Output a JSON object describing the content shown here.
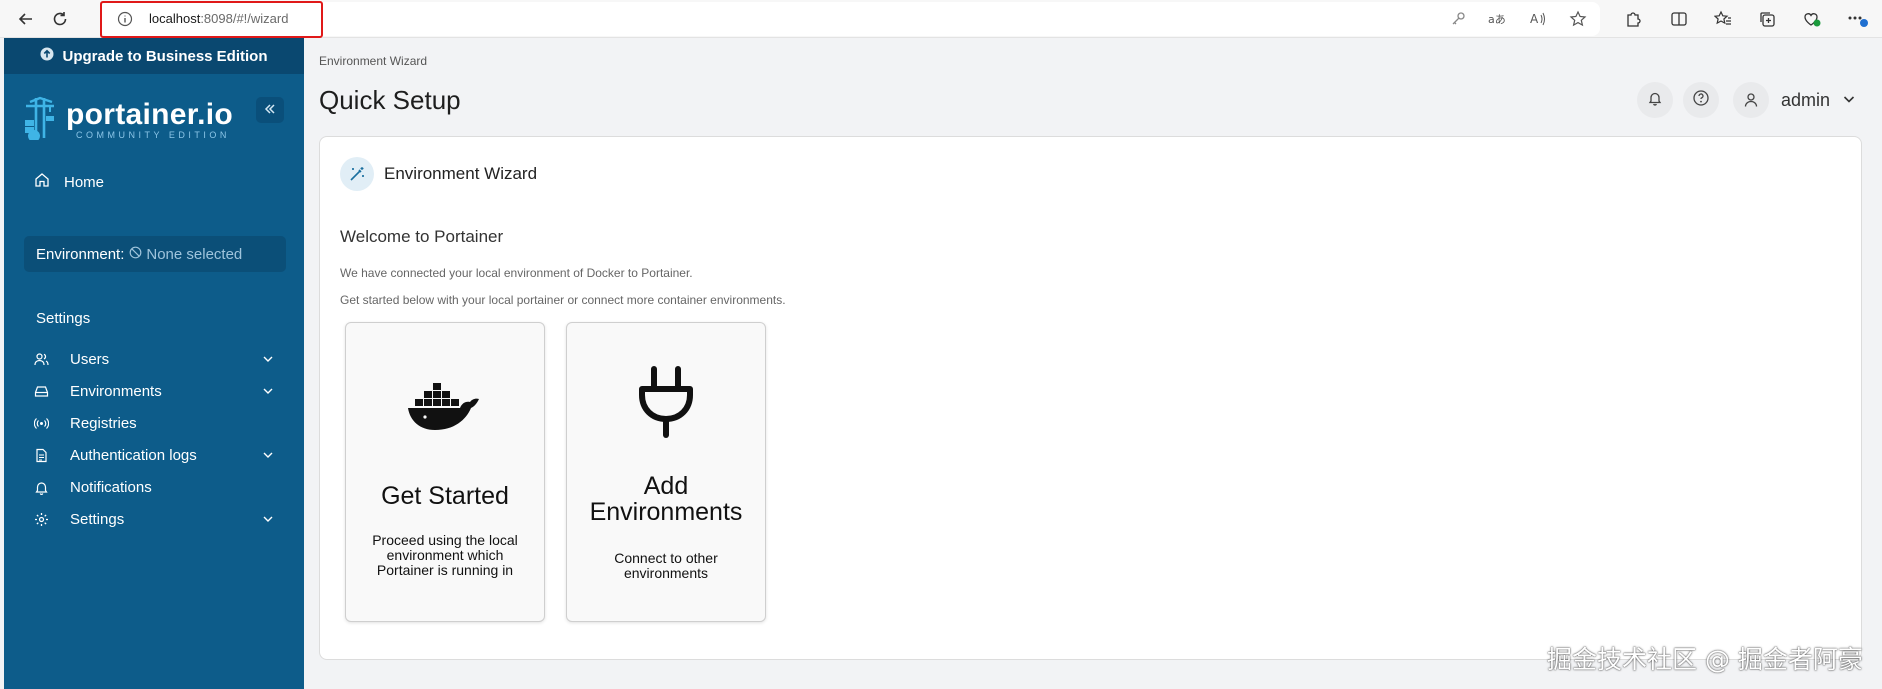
{
  "browser": {
    "url_host": "localhost",
    "url_rest": ":8098/#!/wizard"
  },
  "sidebar": {
    "upgrade_label": "Upgrade to Business Edition",
    "logo_name": "portainer.io",
    "logo_sub": "COMMUNITY EDITION",
    "home_label": "Home",
    "environment_label": "Environment:",
    "environment_value": "None selected",
    "settings_title": "Settings",
    "items": [
      {
        "label": "Users",
        "icon": "users-icon",
        "expandable": true
      },
      {
        "label": "Environments",
        "icon": "environments-icon",
        "expandable": true
      },
      {
        "label": "Registries",
        "icon": "radio-icon",
        "expandable": false
      },
      {
        "label": "Authentication logs",
        "icon": "file-text-icon",
        "expandable": true
      },
      {
        "label": "Notifications",
        "icon": "bell-icon",
        "expandable": false
      },
      {
        "label": "Settings",
        "icon": "gear-icon",
        "expandable": true
      }
    ]
  },
  "header": {
    "breadcrumb": "Environment Wizard",
    "title": "Quick Setup",
    "user": "admin"
  },
  "wizard": {
    "heading": "Environment Wizard",
    "welcome": "Welcome to Portainer",
    "description_1": "We have connected your local environment of Docker to Portainer.",
    "description_2": "Get started below with your local portainer or connect more container environments.",
    "options": [
      {
        "title": "Get Started",
        "description": "Proceed using the local environment which Portainer is running in",
        "icon": "docker-icon"
      },
      {
        "title": "Add Environments",
        "description": "Connect to other environments",
        "icon": "plug-icon"
      }
    ]
  },
  "watermark": "掘金技术社区 @ 掘金者阿豪",
  "colors": {
    "sidebar_bg": "#0d5c8a",
    "upgrade_bg": "#0a4870",
    "page_bg": "#f2f3f5",
    "highlight": "#e01919"
  }
}
